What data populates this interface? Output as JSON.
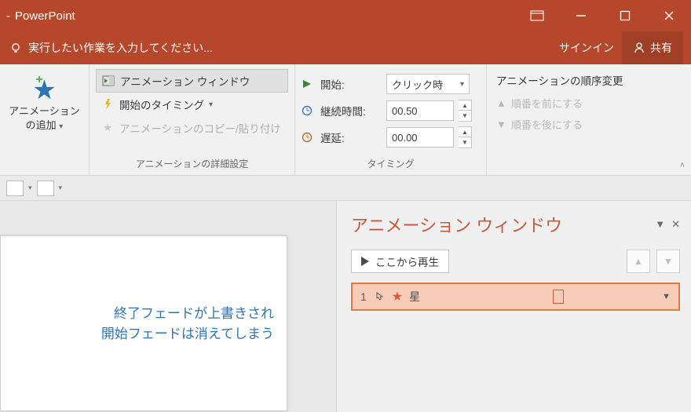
{
  "app_name": "PowerPoint",
  "tellme_placeholder": "実行したい作業を入力してください...",
  "signin": "サインイン",
  "share": "共有",
  "ribbon": {
    "add_animation": {
      "line1": "アニメーション",
      "line2": "の追加"
    },
    "pane_btn": "アニメーション ウィンドウ",
    "trigger_btn": "開始のタイミング",
    "painter_btn": "アニメーションのコピー/貼り付け",
    "group2_label": "アニメーションの詳細設定",
    "start_label": "開始:",
    "start_value": "クリック時",
    "duration_label": "継続時間:",
    "duration_value": "00.50",
    "delay_label": "遅延:",
    "delay_value": "00.00",
    "group3_label": "タイミング",
    "reorder_title": "アニメーションの順序変更",
    "move_earlier": "順番を前にする",
    "move_later": "順番を後にする"
  },
  "slide_text": {
    "line1": "終了フェードが上書きされ",
    "line2": "開始フェードは消えてしまう"
  },
  "pane": {
    "title": "アニメーション ウィンドウ",
    "play_label": "ここから再生",
    "item": {
      "index": "1",
      "name": "星"
    }
  }
}
